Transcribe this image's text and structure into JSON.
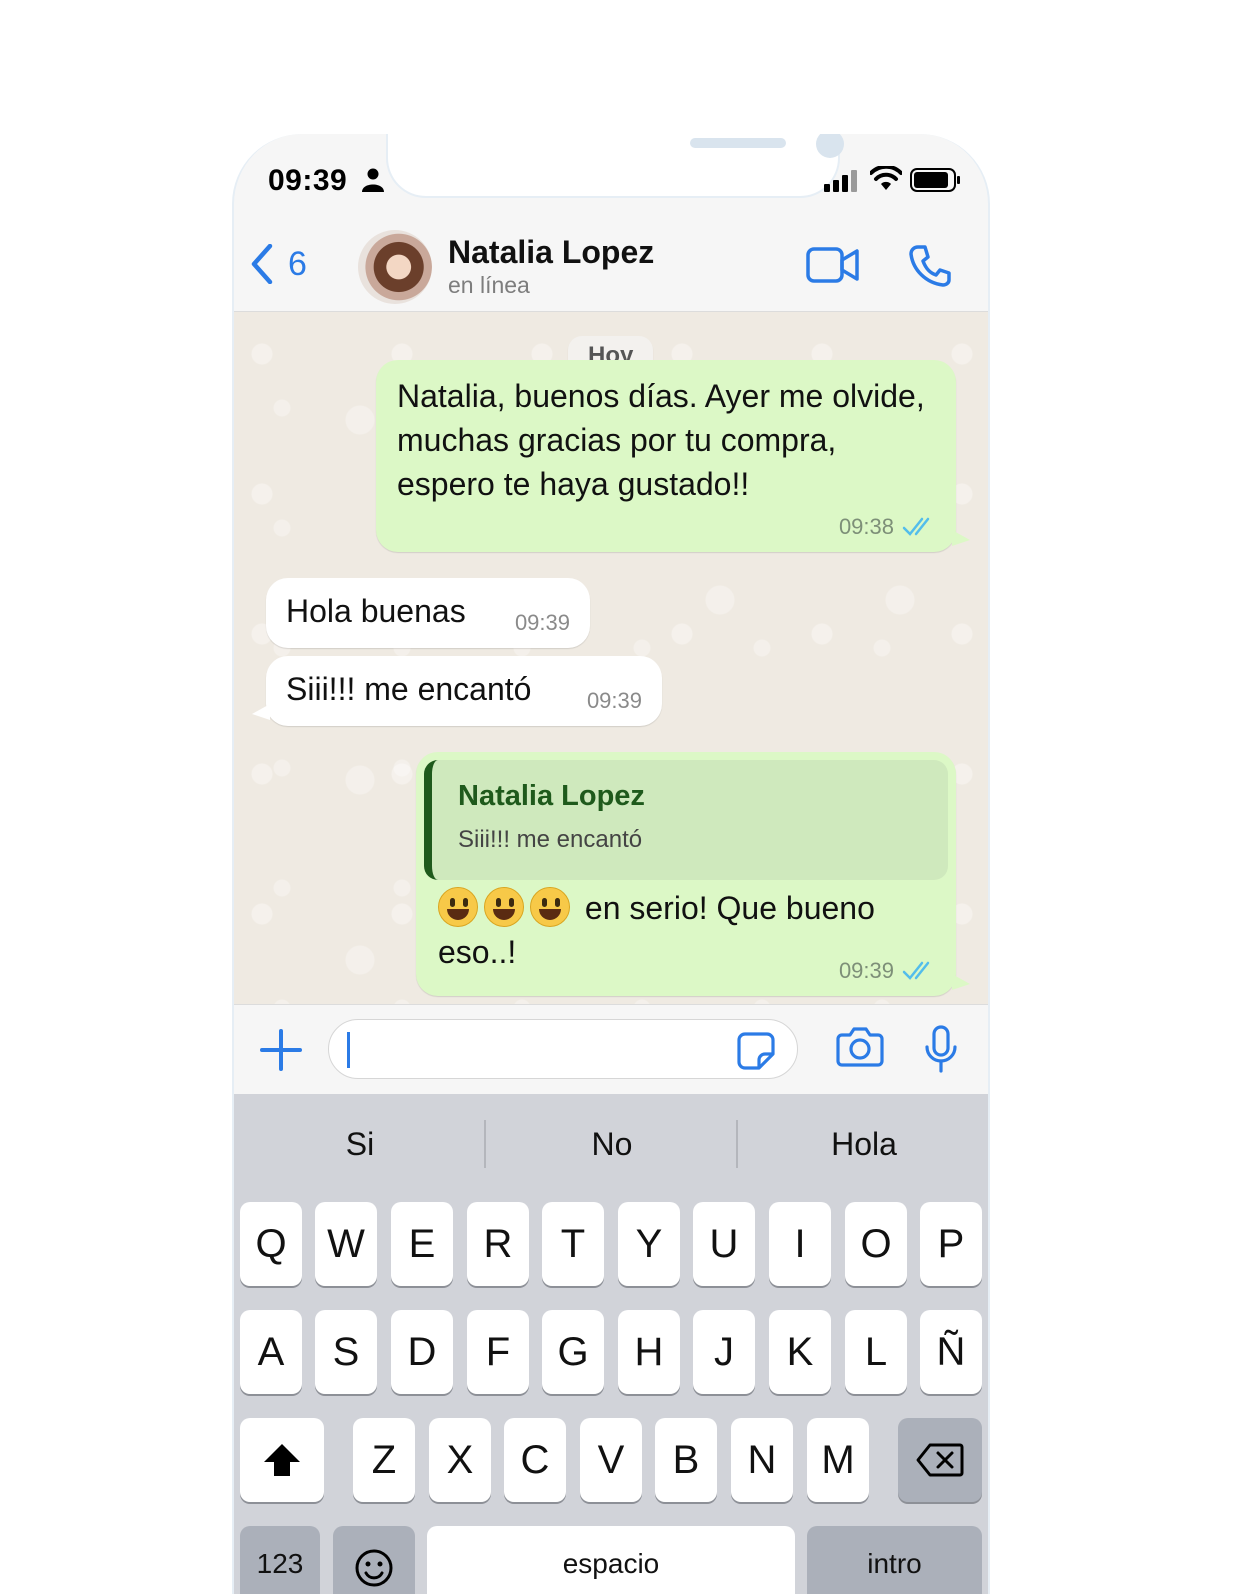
{
  "status_bar": {
    "time": "09:39"
  },
  "header": {
    "back_count": "6",
    "contact_name": "Natalia Lopez",
    "contact_status": "en línea"
  },
  "chat": {
    "date_label": "Hoy",
    "messages": [
      {
        "direction": "outgoing",
        "text": "Natalia, buenos días. Ayer me olvide, muchas gracias por tu compra, espero te haya gustado!!",
        "time": "09:38",
        "status": "read"
      },
      {
        "direction": "incoming",
        "text": "Hola buenas",
        "time": "09:39"
      },
      {
        "direction": "incoming",
        "text": "Siii!!! me encantó",
        "time": "09:39"
      },
      {
        "direction": "outgoing",
        "reply_to": {
          "name": "Natalia Lopez",
          "text": "Siii!!! me encantó"
        },
        "emoji_count": 3,
        "text": "en serio!  Que bueno eso..!",
        "time": "09:39",
        "status": "read"
      }
    ]
  },
  "input": {
    "placeholder": ""
  },
  "keyboard": {
    "suggestions": [
      "Si",
      "No",
      "Hola"
    ],
    "row1": [
      "Q",
      "W",
      "E",
      "R",
      "T",
      "Y",
      "U",
      "I",
      "O",
      "P"
    ],
    "row2": [
      "A",
      "S",
      "D",
      "F",
      "G",
      "H",
      "J",
      "K",
      "L",
      "Ñ"
    ],
    "row3": [
      "Z",
      "X",
      "C",
      "V",
      "B",
      "N",
      "M"
    ],
    "numbers_key": "123",
    "space_key": "espacio",
    "return_key": "intro"
  },
  "colors": {
    "accent": "#2b7be6",
    "outgoing_bubble": "#dcf8c6",
    "incoming_bubble": "#ffffff",
    "read_ticks": "#53bdeb",
    "chat_bg": "#efeae2",
    "quote_name": "#1f5a1c"
  },
  "icons": [
    "person-icon",
    "signal-icon",
    "wifi-icon",
    "battery-icon",
    "back-chevron-icon",
    "video-call-icon",
    "voice-call-icon",
    "plus-icon",
    "sticker-icon",
    "camera-icon",
    "microphone-icon",
    "shift-icon",
    "backspace-icon",
    "emoji-icon",
    "double-check-icon"
  ]
}
